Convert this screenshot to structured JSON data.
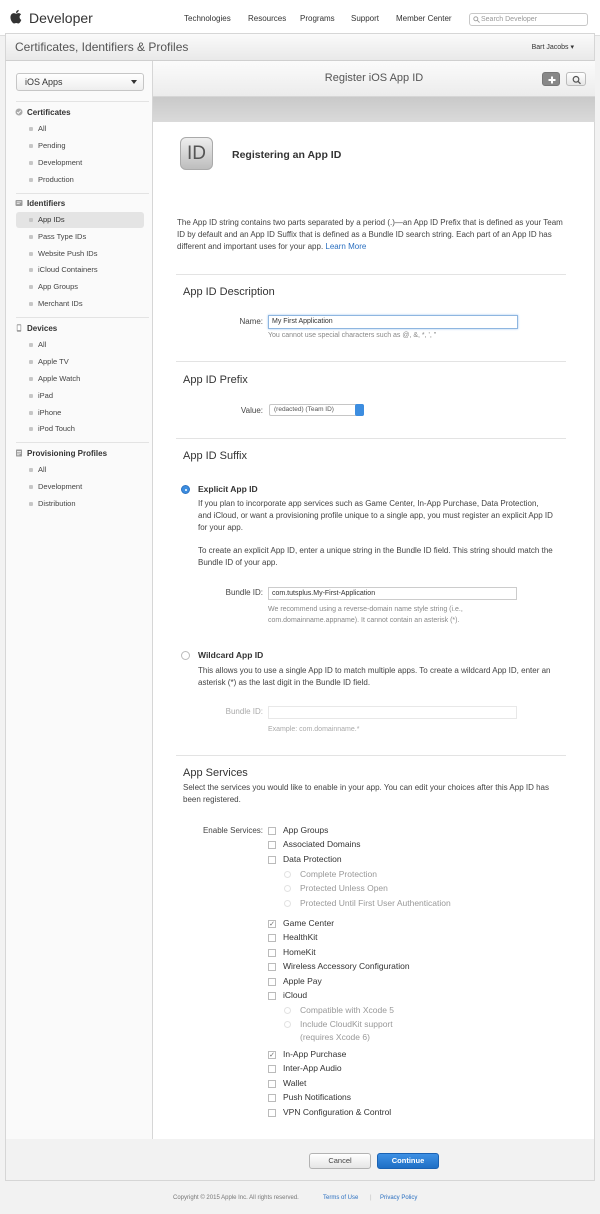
{
  "topnav": {
    "brand": "Developer",
    "links": [
      "Technologies",
      "Resources",
      "Programs",
      "Support",
      "Member Center"
    ],
    "search_placeholder": "Search Developer"
  },
  "header": {
    "title": "Certificates, Identifiers & Profiles",
    "user": "Bart Jacobs"
  },
  "sidebar": {
    "platform": "iOS Apps",
    "sections": [
      {
        "title": "Certificates",
        "icon": "certificate-icon",
        "items": [
          "All",
          "Pending",
          "Development",
          "Production"
        ]
      },
      {
        "title": "Identifiers",
        "icon": "id-icon",
        "items": [
          "App IDs",
          "Pass Type IDs",
          "Website Push IDs",
          "iCloud Containers",
          "App Groups",
          "Merchant IDs"
        ]
      },
      {
        "title": "Devices",
        "icon": "device-icon",
        "items": [
          "All",
          "Apple TV",
          "Apple Watch",
          "iPad",
          "iPhone",
          "iPod Touch"
        ]
      },
      {
        "title": "Provisioning Profiles",
        "icon": "profile-icon",
        "items": [
          "All",
          "Development",
          "Distribution"
        ]
      }
    ],
    "active_item": "App IDs"
  },
  "main": {
    "title": "Register iOS App ID",
    "icon_text": "ID",
    "heading": "Registering an App ID",
    "intro": "The App ID string contains two parts separated by a period (.)—an App ID Prefix that is defined as your Team ID by default and an App ID Suffix that is defined as a Bundle ID search string. Each part of an App ID has different and important uses for your app.",
    "learn_more": "Learn More",
    "description": {
      "title": "App ID Description",
      "name_label": "Name:",
      "name_value": "My First Application",
      "name_hint": "You cannot use special characters such as @, &, *, ', \""
    },
    "prefix": {
      "title": "App ID Prefix",
      "value_label": "Value:",
      "value": "(redacted) (Team ID)"
    },
    "suffix": {
      "title": "App ID Suffix",
      "explicit_label": "Explicit App ID",
      "explicit_desc1": "If you plan to incorporate app services such as Game Center, In-App Purchase, Data Protection, and iCloud, or want a provisioning profile unique to a single app, you must register an explicit App ID for your app.",
      "explicit_desc2": "To create an explicit App ID, enter a unique string in the Bundle ID field. This string should match the Bundle ID of your app.",
      "bundle_label": "Bundle ID:",
      "bundle_value": "com.tutsplus.My-First-Application",
      "bundle_hint": "We recommend using a reverse-domain name style string (i.e., com.domainname.appname). It cannot contain an asterisk (*).",
      "wildcard_label": "Wildcard App ID",
      "wildcard_desc": "This allows you to use a single App ID to match multiple apps. To create a wildcard App ID, enter an asterisk (*) as the last digit in the Bundle ID field.",
      "wildcard_bundle_label": "Bundle ID:",
      "wildcard_hint": "Example: com.domainname.*"
    },
    "services": {
      "title": "App Services",
      "desc": "Select the services you would like to enable in your app. You can edit your choices after this App ID has been registered.",
      "enable_label": "Enable Services:",
      "items": [
        {
          "label": "App Groups",
          "checked": false
        },
        {
          "label": "Associated Domains",
          "checked": false
        },
        {
          "label": "Data Protection",
          "checked": false
        },
        {
          "label": "Complete Protection",
          "sub": true
        },
        {
          "label": "Protected Unless Open",
          "sub": true
        },
        {
          "label": "Protected Until First User Authentication",
          "sub": true
        },
        {
          "label": "Game Center",
          "checked": true
        },
        {
          "label": "HealthKit",
          "checked": false
        },
        {
          "label": "HomeKit",
          "checked": false
        },
        {
          "label": "Wireless Accessory Configuration",
          "checked": false
        },
        {
          "label": "Apple Pay",
          "checked": false
        },
        {
          "label": "iCloud",
          "checked": false
        },
        {
          "label": "Compatible with Xcode 5",
          "sub": true
        },
        {
          "label": "Include CloudKit support",
          "sub": true
        },
        {
          "label": "(requires Xcode 6)",
          "sub": true,
          "cont": true
        },
        {
          "label": "In-App Purchase",
          "checked": true
        },
        {
          "label": "Inter-App Audio",
          "checked": false
        },
        {
          "label": "Wallet",
          "checked": false
        },
        {
          "label": "Push Notifications",
          "checked": false
        },
        {
          "label": "VPN Configuration & Control",
          "checked": false
        }
      ]
    },
    "cancel": "Cancel",
    "continue": "Continue"
  },
  "footer": {
    "copyright": "Copyright © 2015 Apple Inc. All rights reserved.",
    "terms": "Terms of Use",
    "sep": "|",
    "privacy": "Privacy Policy"
  }
}
